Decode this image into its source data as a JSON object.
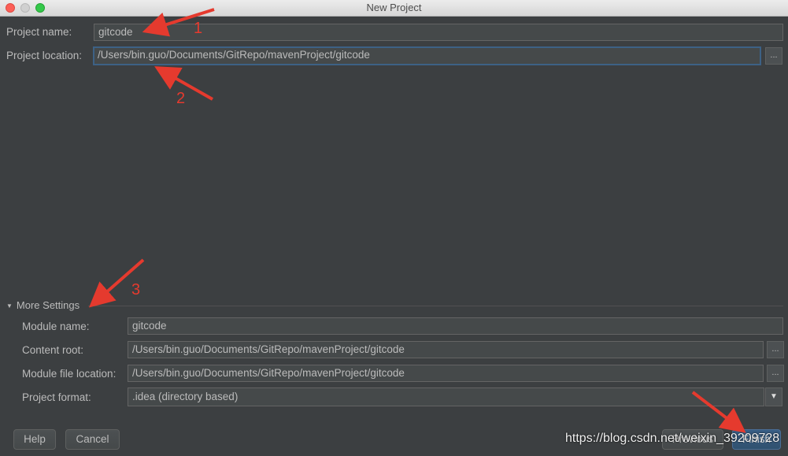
{
  "window": {
    "title": "New Project"
  },
  "project": {
    "name_label": "Project name:",
    "name_value": "gitcode",
    "location_label": "Project location:",
    "location_value": "/Users/bin.guo/Documents/GitRepo/mavenProject/gitcode",
    "browse_label": "..."
  },
  "more_settings": {
    "title": "More Settings",
    "module_name_label": "Module name:",
    "module_name_value": "gitcode",
    "content_root_label": "Content root:",
    "content_root_value": "/Users/bin.guo/Documents/GitRepo/mavenProject/gitcode",
    "module_file_label": "Module file location:",
    "module_file_value": "/Users/bin.guo/Documents/GitRepo/mavenProject/gitcode",
    "format_label": "Project format:",
    "format_value": ".idea (directory based)",
    "browse_label": "..."
  },
  "buttons": {
    "help": "Help",
    "cancel": "Cancel",
    "previous": "Previous",
    "finish": "Finish"
  },
  "annotations": {
    "one": "1",
    "two": "2",
    "three": "3"
  },
  "watermark": "https://blog.csdn.net/weixin_39209728",
  "colors": {
    "background": "#3c3f41",
    "field": "#45494a",
    "focus": "#3d6185",
    "annotation": "#e53a2e"
  }
}
